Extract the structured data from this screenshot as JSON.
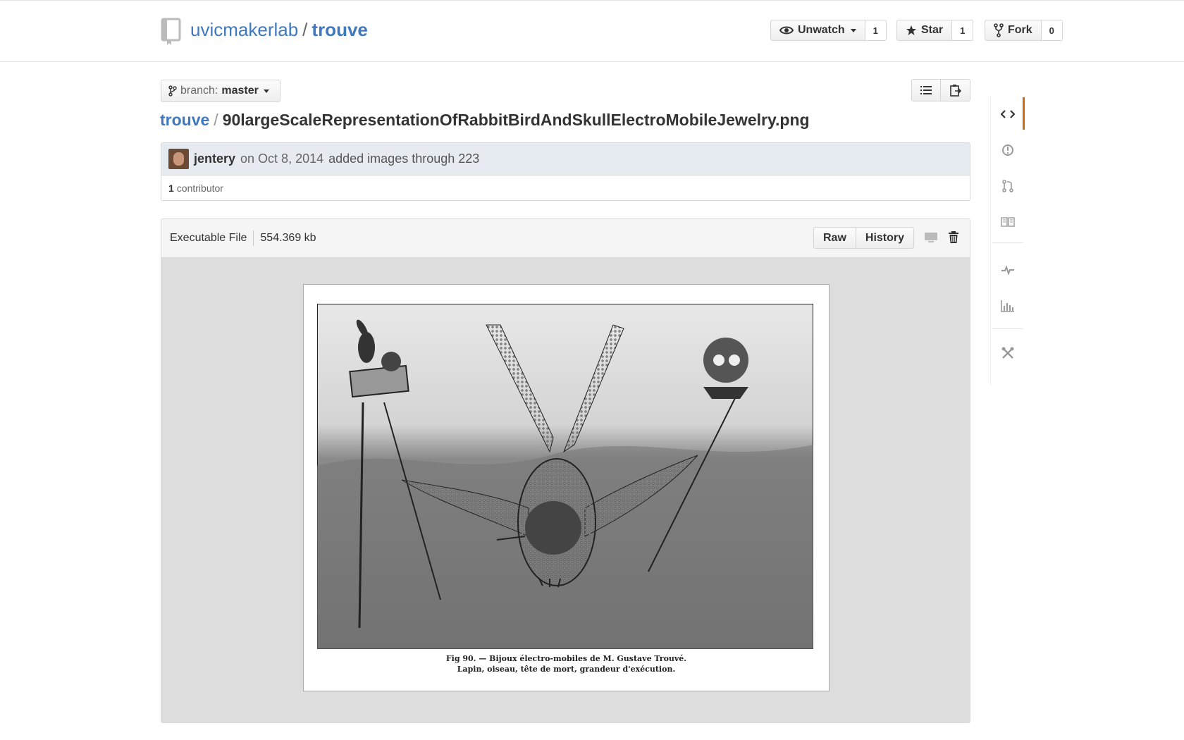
{
  "repo": {
    "owner": "uvicmakerlab",
    "separator": "/",
    "name": "trouve"
  },
  "actions": {
    "watch": {
      "label": "Unwatch",
      "count": "1"
    },
    "star": {
      "label": "Star",
      "count": "1"
    },
    "fork": {
      "label": "Fork",
      "count": "0"
    }
  },
  "branch": {
    "label": "branch:",
    "value": "master"
  },
  "breadcrumb": {
    "root": "trouve",
    "separator": "/",
    "file": "90largeScaleRepresentationOfRabbitBirdAndSkullElectroMobileJewelry.png"
  },
  "commit": {
    "author": "jentery",
    "date": "on Oct 8, 2014",
    "message": "added images through 223"
  },
  "contributors": {
    "count": "1",
    "label": "contributor"
  },
  "file": {
    "mode": "Executable File",
    "size": "554.369 kb",
    "raw_label": "Raw",
    "history_label": "History"
  },
  "image": {
    "caption_line1": "Fig 90. — Bijoux électro-mobiles de M. Gustave Trouvé.",
    "caption_line2": "Lapin, oiseau, tête de mort, grandeur d'exécution."
  },
  "sidebar": {
    "items": [
      "code-icon",
      "issues-icon",
      "pull-request-icon",
      "wiki-icon",
      "pulse-icon",
      "graphs-icon",
      "settings-icon"
    ]
  },
  "colors": {
    "link": "#4078c0",
    "commit_header": "#e6ebf1",
    "active_nav": "#d26911",
    "image_background": "#dddddd"
  }
}
